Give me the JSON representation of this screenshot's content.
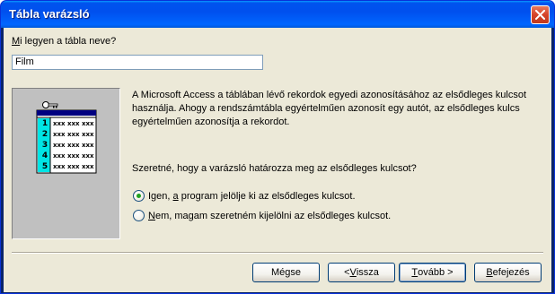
{
  "window": {
    "title": "Tábla varázsló"
  },
  "form": {
    "question_prefix": "M",
    "question_rest": "i legyen a tábla neve?",
    "table_name_value": "Film"
  },
  "illustration": {
    "row_numbers": [
      "1",
      "2",
      "3",
      "4",
      "5"
    ],
    "cell_text": "xxx"
  },
  "info": {
    "description": "A Microsoft Access a táblában lévő rekordok egyedi azonosításához az elsődleges kulcsot használja. Ahogy a rendszámtábla egyértelműen azonosít egy autót, az elsődleges kulcs egyértelműen azonosítja a rekordot.",
    "question": "Szeretné, hogy a varázsló határozza meg az elsődleges kulcsot?"
  },
  "options": [
    {
      "pre": "Igen, ",
      "mnemonic": "a",
      "post": " program jelölje ki az elsődleges kulcsot.",
      "checked": true
    },
    {
      "pre": "",
      "mnemonic": "N",
      "post": "em, magam szeretném kijelölni az elsődleges kulcsot.",
      "checked": false
    }
  ],
  "buttons": {
    "cancel": "Mégse",
    "back_pre": "< ",
    "back_mn": "V",
    "back_post": "issza",
    "next_pre": "",
    "next_mn": "T",
    "next_post": "ovább >",
    "finish_pre": "",
    "finish_mn": "B",
    "finish_post": "efejezés"
  },
  "colors": {
    "accent_green": "#21a121",
    "title_blue": "#0053ee",
    "close_red": "#d5432a"
  }
}
